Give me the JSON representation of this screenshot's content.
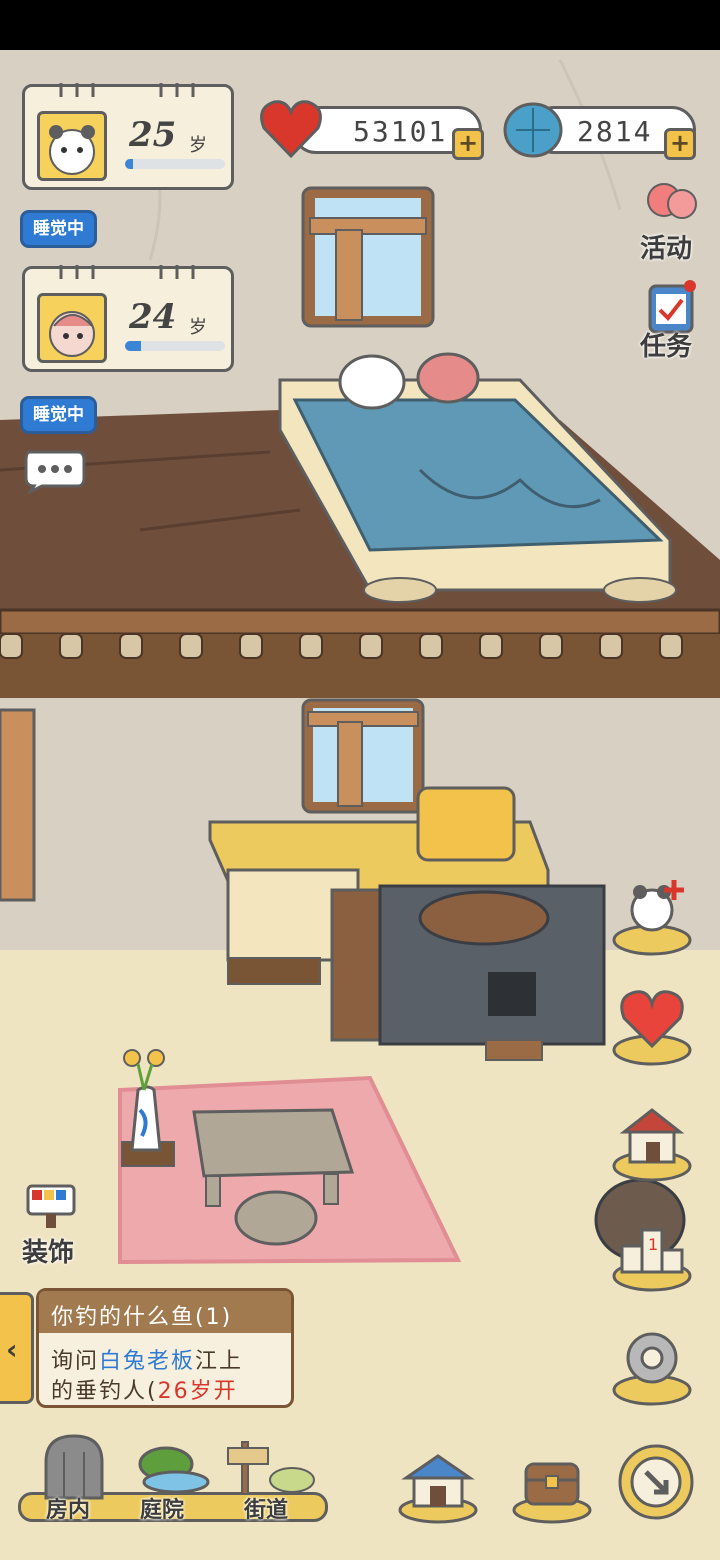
{
  "pets": [
    {
      "age": "25",
      "unit": "岁",
      "status": "睡觉中",
      "progress": 0.08
    },
    {
      "age": "24",
      "unit": "岁",
      "status": "睡觉中",
      "progress": 0.16
    }
  ],
  "resources": {
    "hearts": "53101",
    "shells": "2814"
  },
  "side_menu": {
    "activity": "活动",
    "tasks": "任务"
  },
  "decorate_label": "装饰",
  "quest": {
    "title": "你钓的什么鱼(1)",
    "line1_prefix": "询问",
    "line1_highlight": "白兔老板",
    "line1_suffix": "江上",
    "line2_prefix": "的垂钓人(",
    "line2_highlight": "26岁开"
  },
  "bottom_nav": {
    "room": "房内",
    "yard": "庭院",
    "street": "街道"
  },
  "colors": {
    "wall": "#d8d0c2",
    "floor": "#efe4c2",
    "wood": "#6f4e3c",
    "blue_accent": "#2f7bd4",
    "red_highlight": "#d9372c"
  },
  "icons": [
    "heart-icon",
    "shell-icon",
    "balloon-icon",
    "task-clipboard-icon",
    "panda-add-icon",
    "heart-button-icon",
    "house-button-icon",
    "podium-icon",
    "gear-icon",
    "chat-bubble-icon",
    "paint-icon",
    "home-icon",
    "chest-icon",
    "compass-icon"
  ]
}
